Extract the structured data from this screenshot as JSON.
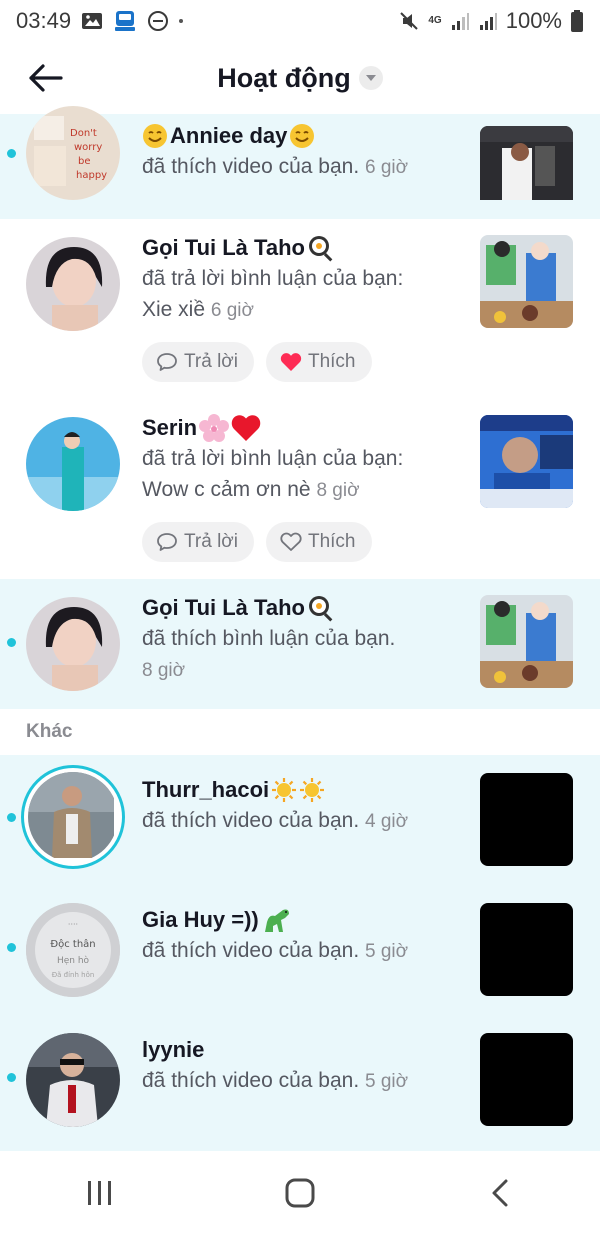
{
  "status_bar": {
    "time": "03:49",
    "battery": "100%",
    "network": "4G"
  },
  "header": {
    "title": "Hoạt động"
  },
  "notifications": [
    {
      "name": "Anniee day",
      "desc": "đã thích video của bạn.",
      "time": "6 giờ",
      "unread": true
    },
    {
      "name": "Gọi Tui Là Taho",
      "desc": "đã trả lời bình luận của bạn:",
      "comment": "Xie xiề",
      "time": "6 giờ",
      "unread": false,
      "reply_label": "Trả lời",
      "like_label": "Thích",
      "liked": true
    },
    {
      "name": "Serin",
      "desc": "đã trả lời bình luận của bạn:",
      "comment": "Wow c cảm ơn nè",
      "time": "8 giờ",
      "unread": false,
      "reply_label": "Trả lời",
      "like_label": "Thích",
      "liked": false
    },
    {
      "name": "Gọi Tui Là Taho",
      "desc": "đã thích bình luận của bạn.",
      "time": "8 giờ",
      "unread": true
    }
  ],
  "section_other": {
    "label": "Khác"
  },
  "other_notifications": [
    {
      "name": "Thurr_hacoi",
      "desc": "đã thích video của bạn.",
      "time": "4 giờ",
      "unread": true
    },
    {
      "name": "Gia Huy =))",
      "desc": "đã thích video của bạn.",
      "time": "5 giờ",
      "unread": true,
      "avatar_line1": "Độc thân",
      "avatar_line2": "Hẹn hò",
      "avatar_line3": "Đã đính hôn"
    },
    {
      "name": "lyynie",
      "desc": "đã thích video của bạn.",
      "time": "5 giờ",
      "unread": true
    }
  ],
  "colors": {
    "accent": "#20c3d9",
    "unread_bg": "#eaf8fb",
    "heart": "#fe2c55",
    "text": "#161823",
    "muted": "#8a8b91"
  },
  "icons": [
    "back-arrow-icon",
    "caret-down-icon",
    "comment-bubble-icon",
    "heart-icon",
    "recents-icon",
    "home-icon",
    "back-chevron-icon"
  ]
}
